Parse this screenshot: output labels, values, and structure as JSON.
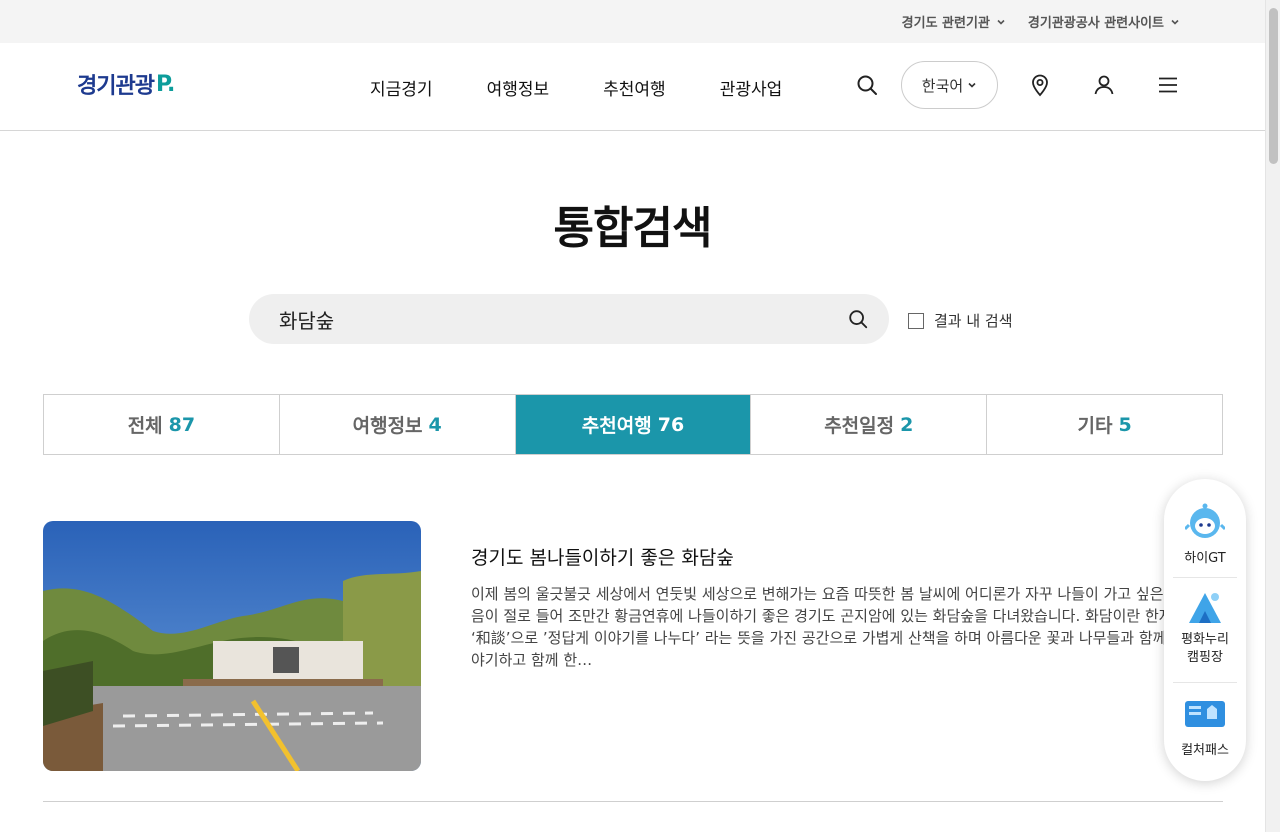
{
  "topbar": {
    "links": [
      {
        "label": "경기도 관련기관"
      },
      {
        "label": "경기관광공사 관련사이트"
      }
    ]
  },
  "header": {
    "logo_text": "경기관광",
    "logo_mark": "P.",
    "nav": [
      "지금경기",
      "여행정보",
      "추천여행",
      "관광사업"
    ],
    "language": "한국어"
  },
  "page": {
    "title": "통합검색"
  },
  "search": {
    "value": "화담숲",
    "in_result_label": "결과 내 검색"
  },
  "tabs": [
    {
      "label": "전체",
      "count": "87",
      "active": false
    },
    {
      "label": "여행정보",
      "count": "4",
      "active": false
    },
    {
      "label": "추천여행",
      "count": "76",
      "active": true
    },
    {
      "label": "추천일정",
      "count": "2",
      "active": false
    },
    {
      "label": "기타",
      "count": "5",
      "active": false
    }
  ],
  "results": [
    {
      "title": "경기도 봄나들이하기 좋은 화담숲",
      "description": "이제 봄의 울긋불긋 세상에서 연둣빛 세상으로 변해가는 요즘 따뜻한 봄 날씨에 어디론가 자꾸 나들이 가고 싶은 마음이 절로 들어 조만간 황금연휴에 나들이하기 좋은 경기도 곤지암에 있는 화담숲을 다녀왔습니다. 화담이란 한자로 ‘和談’으로 ’정답게 이야기를 나누다’ 라는 뜻을 가진 공간으로 가볍게 산책을 하며 아름다운 꽃과 나무들과 함께 이야기하고 함께 한…"
    }
  ],
  "quick_menu": [
    {
      "label": "하이GT",
      "icon": "mascot-icon"
    },
    {
      "label": "평화누리\n캠핑장",
      "icon": "camping-tent-icon"
    },
    {
      "label": "컬처패스",
      "icon": "culture-pass-icon"
    }
  ],
  "colors": {
    "accent": "#1b96aa",
    "logo_blue": "#1d3a8f",
    "logo_green": "#0d9d9b"
  }
}
